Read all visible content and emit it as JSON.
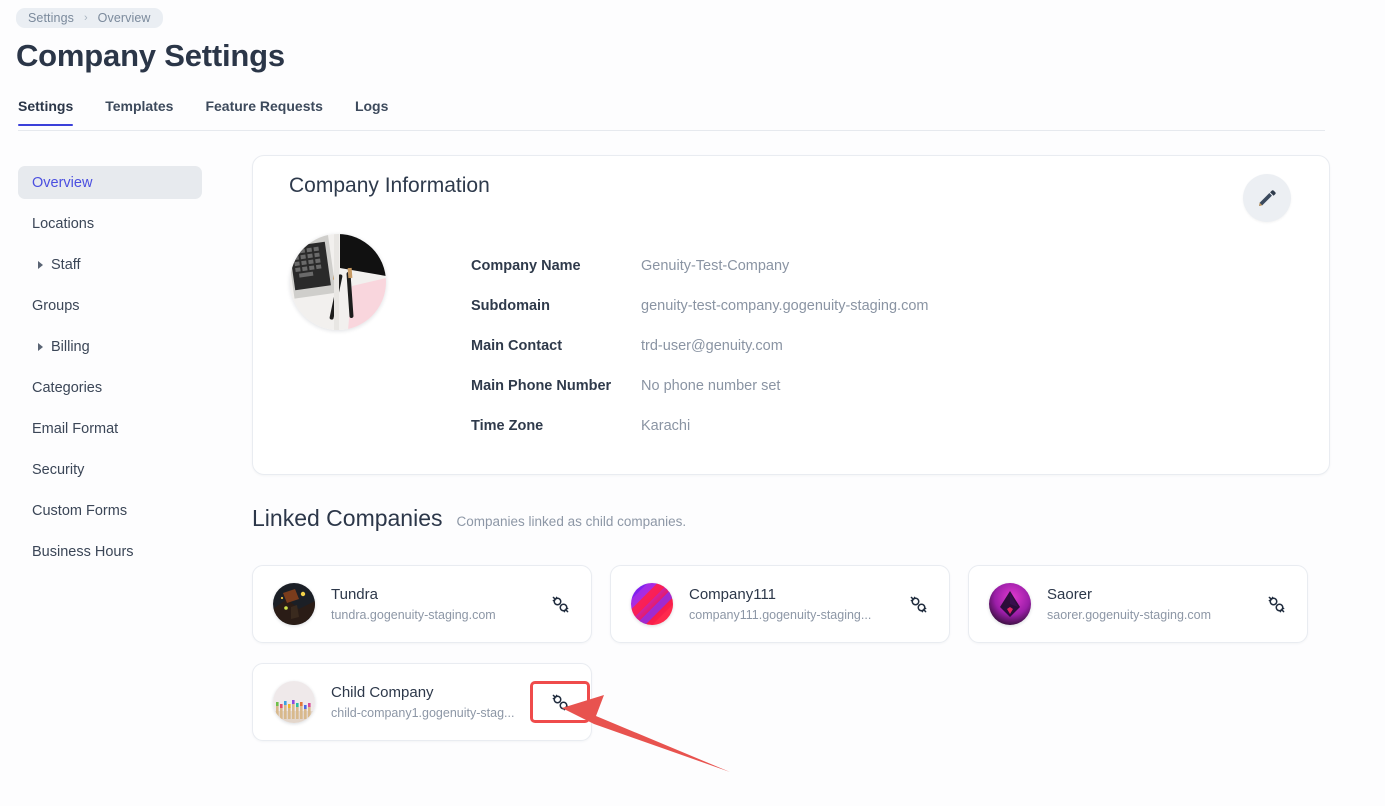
{
  "breadcrumb": {
    "items": [
      "Settings",
      "Overview"
    ],
    "separator": "›"
  },
  "page_title": "Company Settings",
  "tabs": [
    {
      "label": "Settings",
      "active": true
    },
    {
      "label": "Templates",
      "active": false
    },
    {
      "label": "Feature Requests",
      "active": false
    },
    {
      "label": "Logs",
      "active": false
    }
  ],
  "sidebar": {
    "items": [
      {
        "label": "Overview",
        "active": true,
        "expandable": false
      },
      {
        "label": "Locations",
        "active": false,
        "expandable": false
      },
      {
        "label": "Staff",
        "active": false,
        "expandable": true
      },
      {
        "label": "Groups",
        "active": false,
        "expandable": false
      },
      {
        "label": "Billing",
        "active": false,
        "expandable": true
      },
      {
        "label": "Categories",
        "active": false,
        "expandable": false
      },
      {
        "label": "Email Format",
        "active": false,
        "expandable": false
      },
      {
        "label": "Security",
        "active": false,
        "expandable": false
      },
      {
        "label": "Custom Forms",
        "active": false,
        "expandable": false
      },
      {
        "label": "Business Hours",
        "active": false,
        "expandable": false
      }
    ]
  },
  "company_info": {
    "card_title": "Company Information",
    "edit_icon": "pencil-icon",
    "logo_alt": "company-logo-photo",
    "fields": [
      {
        "label": "Company Name",
        "value": "Genuity-Test-Company"
      },
      {
        "label": "Subdomain",
        "value": "genuity-test-company.gogenuity-staging.com"
      },
      {
        "label": "Main Contact",
        "value": "trd-user@genuity.com"
      },
      {
        "label": "Main Phone Number",
        "value": "No phone number set"
      },
      {
        "label": "Time Zone",
        "value": "Karachi"
      }
    ]
  },
  "linked_companies": {
    "title": "Linked Companies",
    "subtitle": "Companies linked as child companies.",
    "unlink_icon": "unlink-icon",
    "cards": [
      {
        "name": "Tundra",
        "domain": "tundra.gogenuity-staging.com",
        "avatar": "dark-night-photo",
        "highlighted": false
      },
      {
        "name": "Company111",
        "domain": "company111.gogenuity-staging...",
        "avatar": "gradient-stripes",
        "highlighted": false
      },
      {
        "name": "Saorer",
        "domain": "saorer.gogenuity-staging.com",
        "avatar": "purple-diamond",
        "highlighted": false
      },
      {
        "name": "Child Company",
        "domain": "child-company1.gogenuity-stag...",
        "avatar": "colored-pencils-photo",
        "highlighted": true
      }
    ]
  },
  "annotation": {
    "highlight_color": "#ef4b4b",
    "arrow_color": "#e8534f",
    "target": "unlink-icon-child-company"
  },
  "colors": {
    "accent": "#3b40d9",
    "sidebar_active_text": "#4b4fe0",
    "sidebar_active_bg": "#e7eaee",
    "text_primary": "#2b3648",
    "text_muted": "#8d97a6",
    "card_border": "#e9ecf1",
    "page_bg": "#fdfdfe"
  }
}
